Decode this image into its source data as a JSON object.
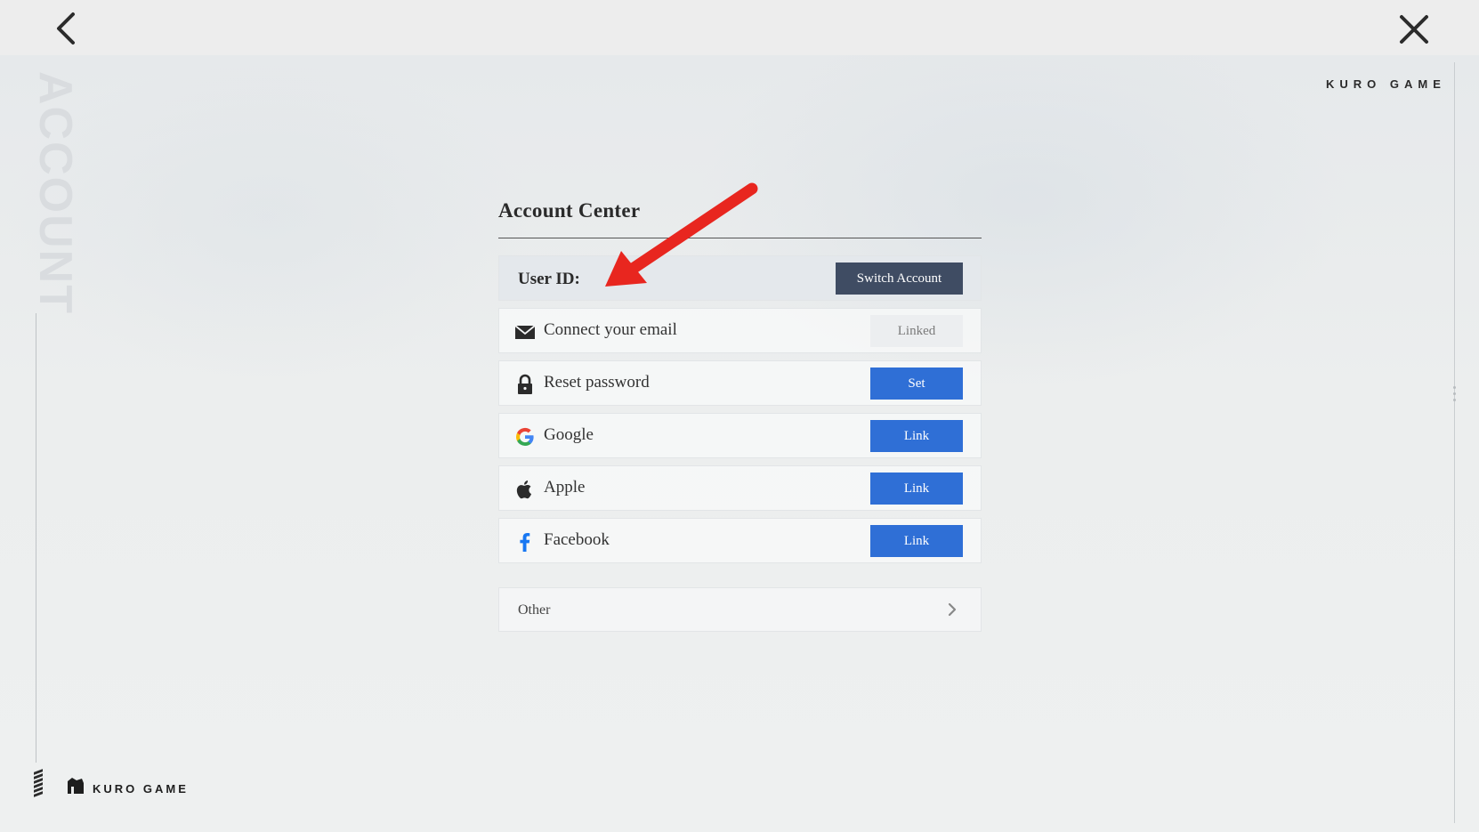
{
  "watermark": "ACCOUNT",
  "brand": {
    "top_text": "KURO GAME",
    "bottom_text": "KURO GAME"
  },
  "panel": {
    "title": "Account Center",
    "user_id_label": "User ID:",
    "switch_account_label": "Switch Account",
    "rows": [
      {
        "icon": "mail-icon",
        "label": "Connect your email",
        "action": "Linked",
        "state": "linked"
      },
      {
        "icon": "lock-icon",
        "label": "Reset password",
        "action": "Set",
        "state": "action"
      },
      {
        "icon": "google-icon",
        "label": "Google",
        "action": "Link",
        "state": "action"
      },
      {
        "icon": "apple-icon",
        "label": "Apple",
        "action": "Link",
        "state": "action"
      },
      {
        "icon": "facebook-icon",
        "label": "Facebook",
        "action": "Link",
        "state": "action"
      }
    ],
    "other_label": "Other"
  },
  "colors": {
    "primary_button": "#2f6fd6",
    "switch_button": "#3f4c63",
    "annotation_arrow": "#e8261f"
  }
}
